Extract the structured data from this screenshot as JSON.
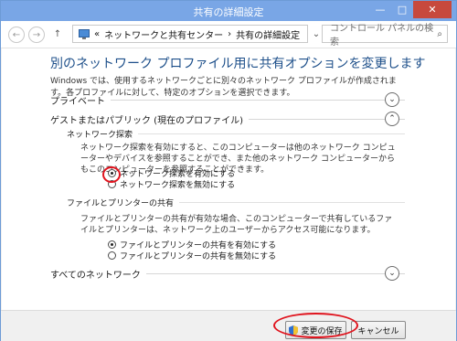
{
  "window": {
    "title": "共有の詳細設定",
    "buttons": {
      "minimize": "—",
      "maximize": "□",
      "close": "✕"
    }
  },
  "nav": {
    "back": "←",
    "forward": "→",
    "up": "↑",
    "breadcrumb_sep": "«",
    "crumbs": [
      "ネットワークと共有センター",
      "共有の詳細設定"
    ],
    "crumb_sep": "›",
    "dropdown": "⌄",
    "refresh": "⟳",
    "search_placeholder": "コントロール パネルの検索",
    "search_icon": "⌕"
  },
  "main": {
    "heading": "別のネットワーク プロファイル用に共有オプションを変更します",
    "description": "Windows では、使用するネットワークごとに別々のネットワーク プロファイルが作成されます。各プロファイルに対して、特定のオプションを選択できます。",
    "sections": {
      "private": {
        "label": "プライベート",
        "chevron": "⌄"
      },
      "guest": {
        "label": "ゲストまたはパブリック (現在のプロファイル)",
        "chevron": "⌃"
      },
      "all": {
        "label": "すべてのネットワーク",
        "chevron": "⌄"
      }
    },
    "discovery": {
      "title": "ネットワーク探索",
      "text": "ネットワーク探索を有効にすると、このコンピューターは他のネットワーク コンピューターやデバイスを参照することができ、また他のネットワーク コンピューターからもこのコンピューターを参照することができます。",
      "options": [
        "ネットワーク探索を有効にする",
        "ネットワーク探索を無効にする"
      ],
      "selected_index": 0
    },
    "sharing": {
      "title": "ファイルとプリンターの共有",
      "text": "ファイルとプリンターの共有が有効な場合、このコンピューターで共有しているファイルとプリンターは、ネットワーク上のユーザーからアクセス可能になります。",
      "options": [
        "ファイルとプリンターの共有を有効にする",
        "ファイルとプリンターの共有を無効にする"
      ],
      "selected_index": 0
    }
  },
  "footer": {
    "save_label": "変更の保存",
    "cancel_label": "キャンセル"
  },
  "colors": {
    "titlebar": "#79a6e6",
    "heading": "#1d4f8a",
    "annotation": "#e0141e",
    "close": "#c7493d"
  }
}
